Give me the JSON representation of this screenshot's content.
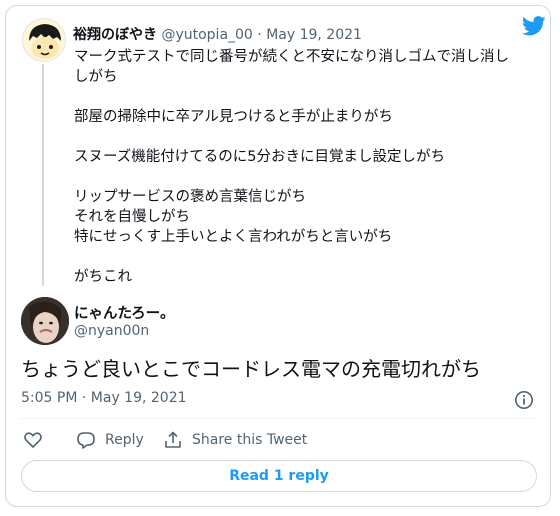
{
  "quoted": {
    "name": "裕翔のぼやき",
    "handle": "@yutopia_00",
    "separator": "·",
    "date": "May 19, 2021",
    "lines": [
      "マーク式テストで同じ番号が続くと不安になり消しゴムで消し消し",
      "しがち",
      "",
      "部屋の掃除中に卒アル見つけると手が止まりがち",
      "",
      "スヌーズ機能付けてるのに5分おきに目覚まし設定しがち",
      "",
      "リップサービスの褒め言葉信じがち",
      "それを自慢しがち",
      "特にせっくす上手いとよく言われがちと言いがち",
      "",
      "がちこれ"
    ]
  },
  "main": {
    "name": "にゃんたろー。",
    "handle": "@nyan00n",
    "text": "ちょうど良いとこでコードレス電マの充電切れがち",
    "time": "5:05 PM",
    "separator": "·",
    "date": "May 19, 2021"
  },
  "actions": {
    "like_label": "",
    "reply_label": "Reply",
    "share_label": "Share this Tweet"
  },
  "read_button": {
    "label": "Read 1 reply"
  },
  "colors": {
    "accent": "#1d9bf0",
    "muted": "#536471",
    "border": "#cfd9de"
  },
  "icons": [
    "twitter-bird-icon",
    "info-icon",
    "heart-icon",
    "reply-icon",
    "share-icon"
  ]
}
